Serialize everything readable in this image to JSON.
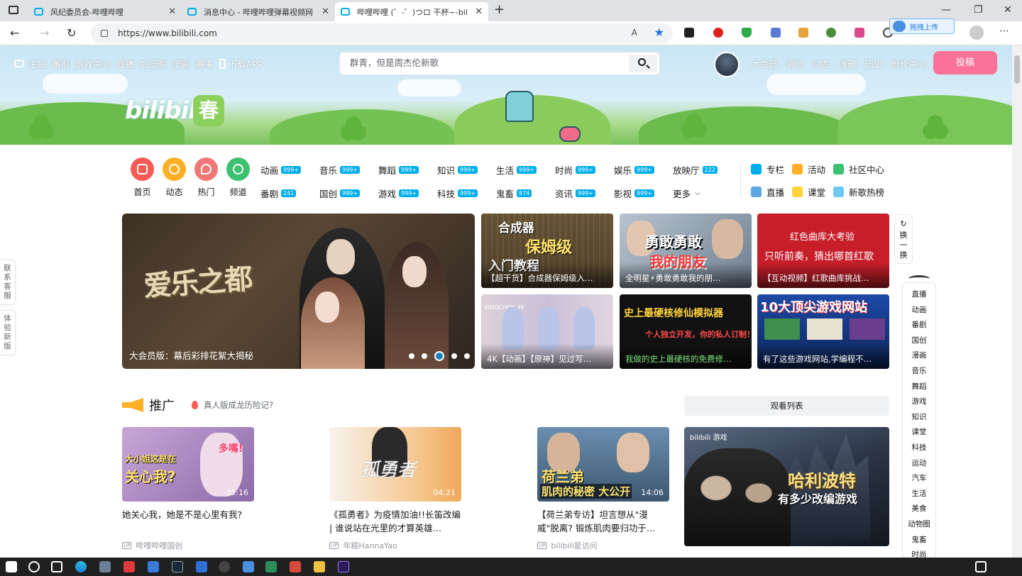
{
  "browser": {
    "tabs": [
      {
        "title": "风纪委员会-哔哩哔哩"
      },
      {
        "title": "消息中心 - 哔哩哔哩弹幕视频网"
      },
      {
        "title": "哔哩哔哩 (゜-゜)つロ 干杯~-bilibili"
      }
    ],
    "new_tab": "+",
    "url": "https://www.bilibili.com",
    "read_aloud": "A",
    "upload_chip": "拖拽上传"
  },
  "header": {
    "nav": [
      "主站",
      "番剧",
      "游戏中心",
      "直播",
      "会员购",
      "漫画",
      "赛事",
      "下载APP"
    ],
    "search_placeholder": "群青，但是周杰伦新歌",
    "right_nav": [
      "大会员",
      "消息",
      "动态",
      "收藏",
      "历史",
      "创作中心"
    ],
    "upload_button": "投稿",
    "logo_text": "bilibili",
    "logo_spring": "春"
  },
  "channels": {
    "icons": [
      {
        "label": "首页",
        "color": "#f85a54"
      },
      {
        "label": "动态",
        "color": "#ffb027"
      },
      {
        "label": "热门",
        "color": "#f07775"
      },
      {
        "label": "频道",
        "color": "#3ec071"
      }
    ],
    "grid": [
      {
        "label": "动画",
        "badge": "999+"
      },
      {
        "label": "音乐",
        "badge": "999+"
      },
      {
        "label": "舞蹈",
        "badge": "999+"
      },
      {
        "label": "知识",
        "badge": "999+"
      },
      {
        "label": "生活",
        "badge": "999+"
      },
      {
        "label": "时尚",
        "badge": "999+"
      },
      {
        "label": "娱乐",
        "badge": "999+"
      },
      {
        "label": "放映厅",
        "badge": "222"
      },
      {
        "label": "番剧",
        "badge": "241"
      },
      {
        "label": "国创",
        "badge": "999+"
      },
      {
        "label": "游戏",
        "badge": "999+"
      },
      {
        "label": "科技",
        "badge": "999+"
      },
      {
        "label": "鬼畜",
        "badge": "874"
      },
      {
        "label": "资讯",
        "badge": "999+"
      },
      {
        "label": "影视",
        "badge": "999+"
      },
      {
        "label": "更多",
        "badge": ""
      }
    ],
    "extra": [
      {
        "label": "专栏",
        "color": "#00aeec"
      },
      {
        "label": "活动",
        "color": "#ffb027"
      },
      {
        "label": "社区中心",
        "color": "#3ec071"
      },
      {
        "label": "直播",
        "color": "#5aa9e6"
      },
      {
        "label": "课堂",
        "color": "#ffd43b"
      },
      {
        "label": "新歌热榜",
        "color": "#6cc9f0"
      }
    ]
  },
  "carousel": {
    "caption": "大会员版：幕后彩排花絮大揭秘",
    "art_title": "爱乐之都",
    "active_index": 2,
    "dot_count": 5
  },
  "cards": [
    {
      "caption": "【超干货】合成器保姆级入…",
      "art1": "合成器",
      "art2": "保姆级",
      "art3": "入门教程"
    },
    {
      "caption": "全明星⚡勇敢勇敢我的朋…",
      "art1": "勇敢勇敢",
      "art2": "我的朋友"
    },
    {
      "caption": "【互动视频】红歌曲库挑战…",
      "art1": "红色曲库大考验",
      "art2": "只听前奏，猜出哪首红歌"
    },
    {
      "caption": "4K【动画】【原神】见过写…",
      "art1": "XIMOCHEN 4K"
    },
    {
      "caption": "我做的史上最硬核的免费修…",
      "art1": "史上最硬核修仙模拟器",
      "art2": "个人独立开发，你的私人订制！"
    },
    {
      "caption": "有了这些游戏网站,学编程不…",
      "art1": "10大顶尖游戏网站"
    }
  ],
  "swap_button": "换一换",
  "promo": {
    "title": "推广",
    "hot": "真人版成龙历险记?",
    "watchlist": "观看列表",
    "videos": [
      {
        "title": "她关心我，她是不是心里有我?",
        "duration": "25:16",
        "up": "哔哩哔哩国创",
        "art1": "大小姐这是在",
        "art2": "关心我?",
        "art3": "多嘴!"
      },
      {
        "title": "《孤勇者》为疫情加油!!长笛改编 | 谁说站在光里的才算英雄…",
        "duration": "04:21",
        "up": "年糕HannaYao",
        "art1": "孤勇者"
      },
      {
        "title": "【荷兰弟专访】坦言想从\"漫威\"脱离? 锻炼肌肉要归功于…",
        "duration": "14:06",
        "up": "bilibili星访问",
        "art1": "荷兰弟",
        "art2": "肌肉的秘密 大公开"
      }
    ],
    "up_tag": "UP",
    "ad": {
      "tag": "bilibili 游戏",
      "title": "哈利波特",
      "subtitle": "有多少改编游戏"
    }
  },
  "float_left": [
    "联系客服",
    "体验新版"
  ],
  "right_nav": [
    "直播",
    "动画",
    "番剧",
    "国创",
    "漫画",
    "音乐",
    "舞蹈",
    "游戏",
    "知识",
    "课堂",
    "科技",
    "运动",
    "汽车",
    "生活",
    "美食",
    "动物圈",
    "鬼畜",
    "时尚"
  ]
}
